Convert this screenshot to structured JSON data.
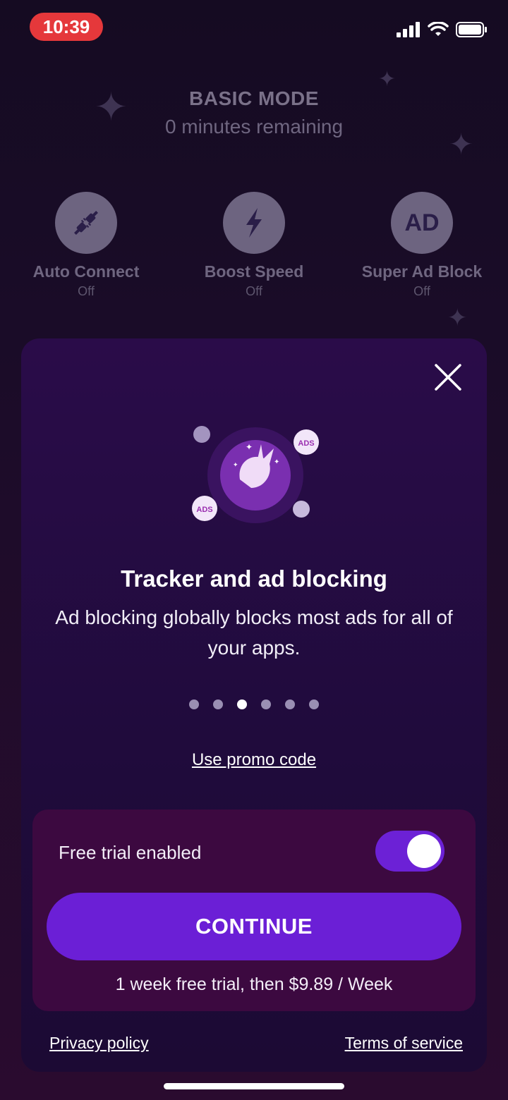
{
  "status_bar": {
    "time": "10:39"
  },
  "header": {
    "mode": "BASIC MODE",
    "remaining": "0 minutes remaining"
  },
  "features": [
    {
      "label": "Auto Connect",
      "state": "Off",
      "icon": "plug-icon"
    },
    {
      "label": "Boost Speed",
      "state": "Off",
      "icon": "lightning-icon"
    },
    {
      "label": "Super Ad Block",
      "state": "Off",
      "icon": "ad-icon",
      "icon_text": "AD"
    }
  ],
  "modal": {
    "title": "Tracker and ad blocking",
    "description": "Ad blocking globally blocks most ads for all of your apps.",
    "ads_badge": "ADS",
    "pagination": {
      "total": 6,
      "active_index": 2
    },
    "promo_link": "Use promo code",
    "trial_toggle_label": "Free trial enabled",
    "trial_enabled": true,
    "continue_label": "CONTINUE",
    "trial_info": "1 week free trial, then $9.89 / Week",
    "privacy_label": "Privacy policy",
    "terms_label": "Terms of service"
  },
  "colors": {
    "accent": "#6b1fd6",
    "time_pill": "#e5383b",
    "trial_box": "#3c0940"
  }
}
